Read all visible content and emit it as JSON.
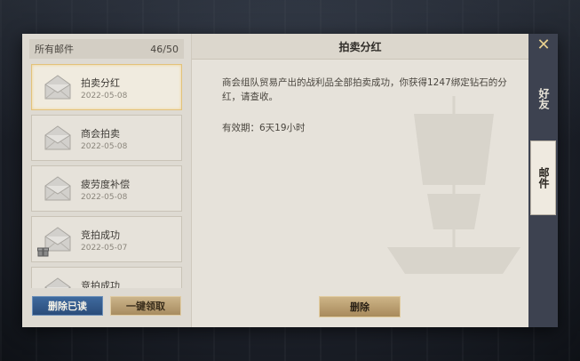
{
  "mail_panel": {
    "header_label": "所有邮件",
    "count": "46/50",
    "items": [
      {
        "title": "拍卖分红",
        "date": "2022-05-08",
        "selected": true,
        "gift": false
      },
      {
        "title": "商会拍卖",
        "date": "2022-05-08",
        "selected": false,
        "gift": false
      },
      {
        "title": "疲劳度补偿",
        "date": "2022-05-08",
        "selected": false,
        "gift": false
      },
      {
        "title": "竞拍成功",
        "date": "2022-05-07",
        "selected": false,
        "gift": true
      },
      {
        "title": "竞拍成功",
        "date": "",
        "selected": false,
        "gift": false
      }
    ],
    "delete_read_label": "删除已读",
    "claim_all_label": "一键领取"
  },
  "detail": {
    "title": "拍卖分红",
    "body": "商会组队贸易产出的战利品全部拍卖成功，你获得1247绑定钻石的分红，请查收。",
    "validity": "有效期：6天19小时",
    "delete_label": "删除"
  },
  "side_tabs": {
    "friends": "好友",
    "mail": "邮件",
    "close_icon": "close-icon"
  },
  "colors": {
    "panel_bg": "#e9e5dd",
    "accent_gold": "#e3c27a",
    "blue_button": "#2a4c7a",
    "side_bar": "#3d4250"
  }
}
